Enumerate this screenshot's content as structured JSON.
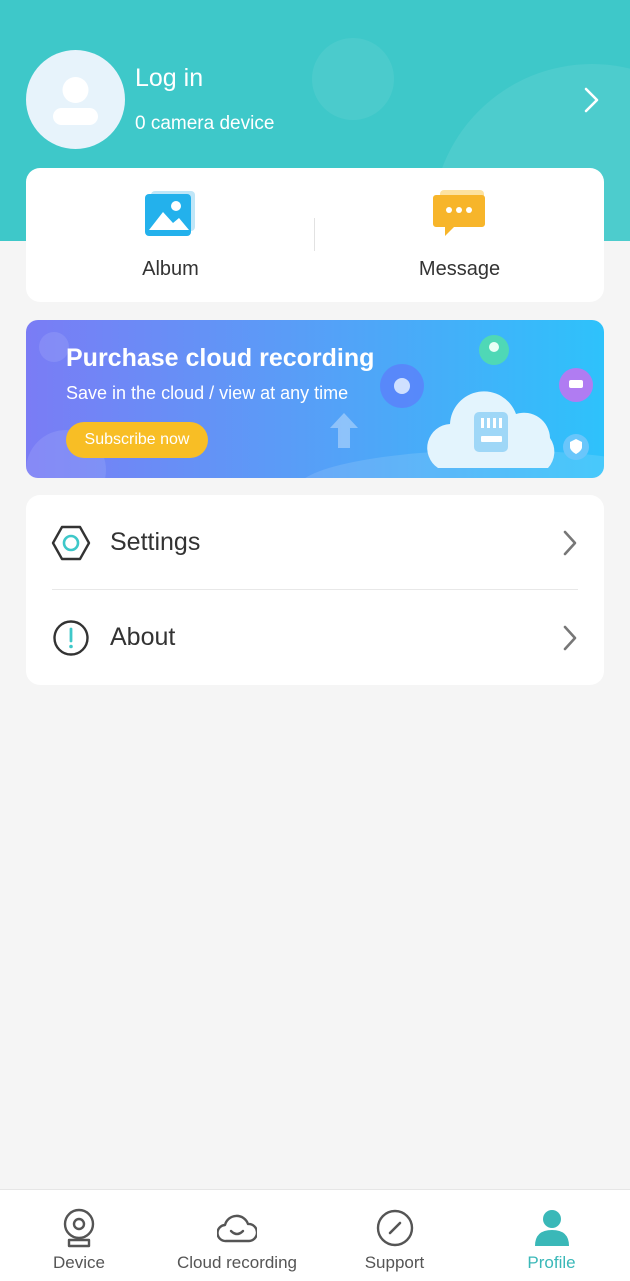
{
  "header": {
    "title": "Log in",
    "subtitle": "0 camera device",
    "background_color": "#3ec8c9"
  },
  "quick_actions": [
    {
      "label": "Album",
      "icon": "album-icon"
    },
    {
      "label": "Message",
      "icon": "message-icon"
    }
  ],
  "banner": {
    "title": "Purchase cloud recording",
    "subtitle": "Save in the cloud / view at any time",
    "button_label": "Subscribe now",
    "button_color": "#f8be25"
  },
  "menu": [
    {
      "label": "Settings",
      "icon": "settings-icon"
    },
    {
      "label": "About",
      "icon": "info-icon"
    }
  ],
  "tabs": [
    {
      "label": "Device",
      "icon": "camera-icon",
      "active": false
    },
    {
      "label": "Cloud recording",
      "icon": "cloud-icon",
      "active": false
    },
    {
      "label": "Support",
      "icon": "compass-icon",
      "active": false
    },
    {
      "label": "Profile",
      "icon": "person-icon",
      "active": true
    }
  ],
  "colors": {
    "accent": "#3ab8b8",
    "page_background": "#f5f5f5"
  }
}
